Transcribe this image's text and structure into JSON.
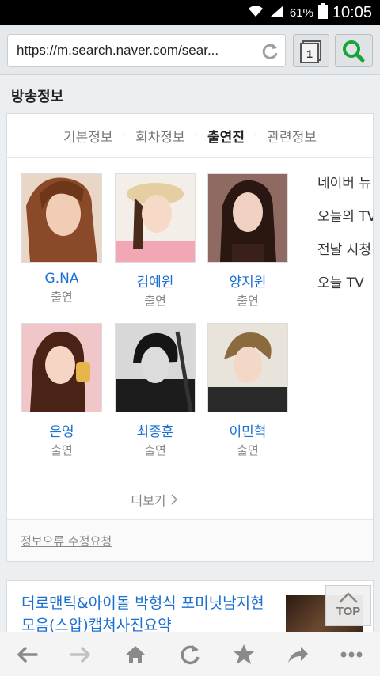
{
  "status": {
    "battery_pct": "61%",
    "time": "10:05"
  },
  "browser": {
    "url": "https://m.search.naver.com/sear...",
    "tab_count": "1"
  },
  "section": {
    "title": "방송정보"
  },
  "tabs": [
    {
      "label": "기본정보"
    },
    {
      "label": "회차정보"
    },
    {
      "label": "출연진"
    },
    {
      "label": "관련정보"
    }
  ],
  "tab_separator": "·",
  "cast": [
    {
      "name": "G.NA",
      "role": "출연"
    },
    {
      "name": "김예원",
      "role": "출연"
    },
    {
      "name": "양지원",
      "role": "출연"
    },
    {
      "name": "은영",
      "role": "출연"
    },
    {
      "name": "최종훈",
      "role": "출연"
    },
    {
      "name": "이민혁",
      "role": "출연"
    }
  ],
  "more_label": "더보기",
  "side_links": [
    {
      "label": "네이버 뉴"
    },
    {
      "label": "오늘의 TV"
    },
    {
      "label": "전날 시청"
    },
    {
      "label": "오늘 TV"
    }
  ],
  "report_link": "정보오류 수정요청",
  "article": {
    "headline": "더로맨틱&아이돌 박형식 포미닛남지현 모음(스압)캡쳐사진요약"
  },
  "top_button": "TOP"
}
